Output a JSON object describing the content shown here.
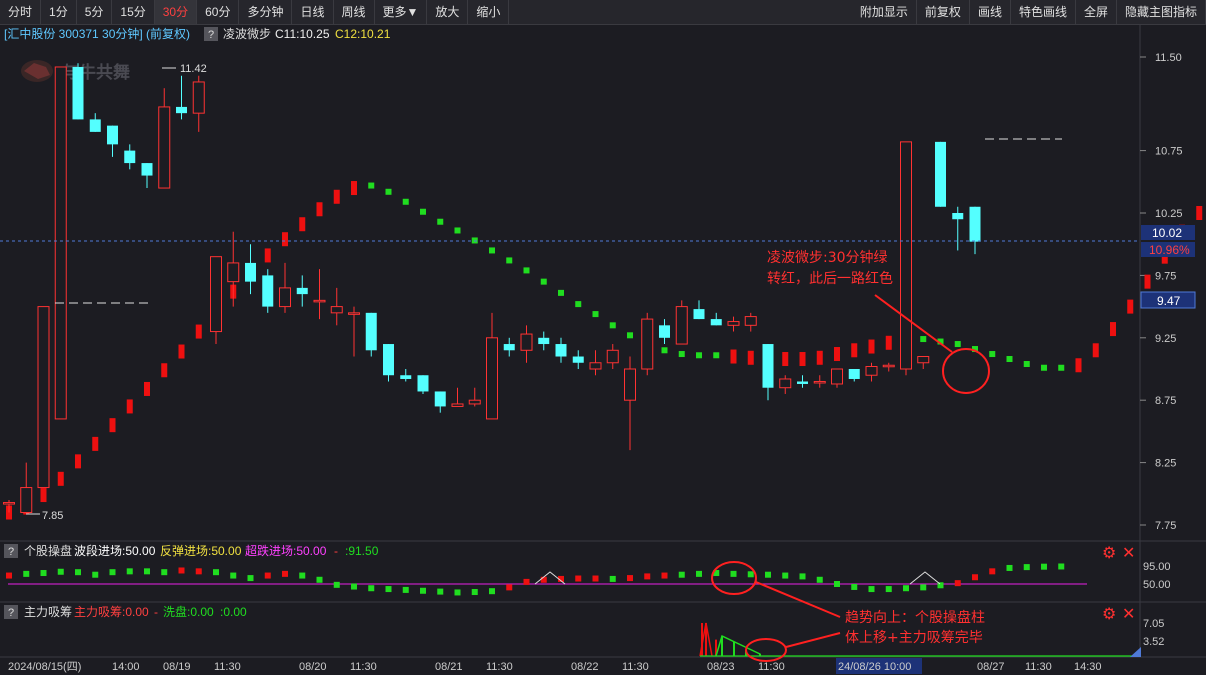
{
  "toolbar": {
    "left": [
      "分时",
      "1分",
      "5分",
      "15分",
      "30分",
      "60分",
      "多分钟",
      "日线",
      "周线",
      "更多▼",
      "放大",
      "缩小"
    ],
    "active": "30分",
    "right": [
      "附加显示",
      "前复权",
      "画线",
      "特色画线",
      "全屏",
      "隐藏主图指标"
    ]
  },
  "main_panel": {
    "stock_label": "[汇中股份 300371 30分钟] (前复权)",
    "help_badge": "?",
    "indicator_name": "凌波微步",
    "c1_text": "C11:10.25",
    "c2_text": "C12:10.21",
    "watermark": "与牛共舞",
    "high_label": "11.42",
    "low_label": "7.85",
    "price_box": "10.02",
    "pct_box": "10.96%",
    "level_box": "9.47",
    "y_ticks": [
      "11.50",
      "10.75",
      "10.25",
      "9.75",
      "9.25",
      "8.75",
      "8.25",
      "7.75"
    ]
  },
  "panel2": {
    "help_badge": "?",
    "name": "个股操盘",
    "s1": "波段进场:50.00",
    "s2": "反弹进场:50.00",
    "s3": "超跌进场:50.00",
    "s4": "-",
    "s5": ":91.50",
    "y_ticks": [
      "95.00",
      "50.00"
    ]
  },
  "panel3": {
    "help_badge": "?",
    "name": "主力吸筹",
    "s1": "主力吸筹:0.00",
    "s2": "-",
    "s3": "洗盘:0.00",
    "s4": ":0.00",
    "y_ticks": [
      "7.05",
      "3.52"
    ]
  },
  "xaxis": {
    "labels": [
      "2024/08/15(四)",
      "14:00",
      "08/19",
      "11:30",
      "08/20",
      "11:30",
      "08/21",
      "11:30",
      "08/22",
      "11:30",
      "08/23",
      "11:30",
      "24/08/26 10:00",
      "08/27",
      "11:30",
      "14:30"
    ],
    "highlight": "24/08/26 10:00"
  },
  "annotations": {
    "a1_line1": "凌波微步:30分钟绿",
    "a1_line2": "转红，此后一路红色",
    "a2_line1": "趋势向上：个股操盘柱",
    "a2_line2": "体上移+主力吸筹完毕"
  },
  "colors": {
    "up": "#ff3232",
    "down": "#54ffff",
    "dot_green": "#20dd20",
    "dot_red": "#ee1010",
    "axis": "#cccccc",
    "grid": "#2e2e36"
  },
  "chart_data": {
    "type": "candlestick",
    "ylim": [
      7.7,
      11.6
    ],
    "candles": [
      {
        "o": 7.92,
        "h": 7.95,
        "l": 7.85,
        "c": 7.93
      },
      {
        "o": 7.85,
        "h": 8.25,
        "l": 7.85,
        "c": 8.05
      },
      {
        "o": 8.05,
        "h": 9.5,
        "l": 8.05,
        "c": 9.5
      },
      {
        "o": 8.6,
        "h": 11.42,
        "l": 8.6,
        "c": 11.42
      },
      {
        "o": 11.42,
        "h": 11.45,
        "l": 11.0,
        "c": 11.0
      },
      {
        "o": 11.0,
        "h": 11.05,
        "l": 10.9,
        "c": 10.9
      },
      {
        "o": 10.95,
        "h": 10.95,
        "l": 10.7,
        "c": 10.8
      },
      {
        "o": 10.75,
        "h": 10.8,
        "l": 10.6,
        "c": 10.65
      },
      {
        "o": 10.65,
        "h": 10.65,
        "l": 10.45,
        "c": 10.55
      },
      {
        "o": 10.45,
        "h": 11.25,
        "l": 10.45,
        "c": 11.1
      },
      {
        "o": 11.1,
        "h": 11.35,
        "l": 11.0,
        "c": 11.05
      },
      {
        "o": 11.05,
        "h": 11.35,
        "l": 10.9,
        "c": 11.3
      },
      {
        "o": 9.3,
        "h": 9.9,
        "l": 9.2,
        "c": 9.9
      },
      {
        "o": 9.7,
        "h": 10.1,
        "l": 9.5,
        "c": 9.85
      },
      {
        "o": 9.85,
        "h": 10.0,
        "l": 9.6,
        "c": 9.7
      },
      {
        "o": 9.75,
        "h": 9.8,
        "l": 9.45,
        "c": 9.5
      },
      {
        "o": 9.5,
        "h": 9.85,
        "l": 9.45,
        "c": 9.65
      },
      {
        "o": 9.65,
        "h": 9.75,
        "l": 9.5,
        "c": 9.6
      },
      {
        "o": 9.55,
        "h": 9.8,
        "l": 9.4,
        "c": 9.55
      },
      {
        "o": 9.45,
        "h": 9.65,
        "l": 9.35,
        "c": 9.5
      },
      {
        "o": 9.45,
        "h": 9.5,
        "l": 9.1,
        "c": 9.45
      },
      {
        "o": 9.45,
        "h": 9.45,
        "l": 9.1,
        "c": 9.15
      },
      {
        "o": 9.2,
        "h": 9.2,
        "l": 8.9,
        "c": 8.95
      },
      {
        "o": 8.95,
        "h": 9.0,
        "l": 8.9,
        "c": 8.92
      },
      {
        "o": 8.95,
        "h": 8.95,
        "l": 8.8,
        "c": 8.82
      },
      {
        "o": 8.82,
        "h": 8.82,
        "l": 8.65,
        "c": 8.7
      },
      {
        "o": 8.7,
        "h": 8.85,
        "l": 8.7,
        "c": 8.72
      },
      {
        "o": 8.72,
        "h": 8.85,
        "l": 8.7,
        "c": 8.75
      },
      {
        "o": 8.6,
        "h": 9.45,
        "l": 8.6,
        "c": 9.25
      },
      {
        "o": 9.2,
        "h": 9.25,
        "l": 9.1,
        "c": 9.15
      },
      {
        "o": 9.15,
        "h": 9.35,
        "l": 9.05,
        "c": 9.28
      },
      {
        "o": 9.25,
        "h": 9.3,
        "l": 9.15,
        "c": 9.2
      },
      {
        "o": 9.2,
        "h": 9.25,
        "l": 9.05,
        "c": 9.1
      },
      {
        "o": 9.1,
        "h": 9.15,
        "l": 9.0,
        "c": 9.05
      },
      {
        "o": 9.0,
        "h": 9.15,
        "l": 8.95,
        "c": 9.05
      },
      {
        "o": 9.05,
        "h": 9.2,
        "l": 9.0,
        "c": 9.15
      },
      {
        "o": 8.75,
        "h": 9.1,
        "l": 8.35,
        "c": 9.0
      },
      {
        "o": 9.0,
        "h": 9.45,
        "l": 8.95,
        "c": 9.4
      },
      {
        "o": 9.35,
        "h": 9.4,
        "l": 9.2,
        "c": 9.25
      },
      {
        "o": 9.2,
        "h": 9.55,
        "l": 9.2,
        "c": 9.5
      },
      {
        "o": 9.48,
        "h": 9.55,
        "l": 9.4,
        "c": 9.4
      },
      {
        "o": 9.4,
        "h": 9.45,
        "l": 9.35,
        "c": 9.35
      },
      {
        "o": 9.35,
        "h": 9.42,
        "l": 9.3,
        "c": 9.38
      },
      {
        "o": 9.35,
        "h": 9.45,
        "l": 9.3,
        "c": 9.42
      },
      {
        "o": 9.2,
        "h": 9.2,
        "l": 8.75,
        "c": 8.85
      },
      {
        "o": 8.85,
        "h": 8.95,
        "l": 8.8,
        "c": 8.92
      },
      {
        "o": 8.9,
        "h": 8.95,
        "l": 8.85,
        "c": 8.88
      },
      {
        "o": 8.9,
        "h": 8.95,
        "l": 8.85,
        "c": 8.9
      },
      {
        "o": 8.88,
        "h": 9.0,
        "l": 8.85,
        "c": 9.0
      },
      {
        "o": 9.0,
        "h": 9.0,
        "l": 8.9,
        "c": 8.92
      },
      {
        "o": 8.95,
        "h": 9.05,
        "l": 8.9,
        "c": 9.02
      },
      {
        "o": 9.02,
        "h": 9.05,
        "l": 8.98,
        "c": 9.03
      },
      {
        "o": 9.0,
        "h": 10.82,
        "l": 8.95,
        "c": 10.82
      },
      {
        "o": 9.05,
        "h": 9.1,
        "l": 9.0,
        "c": 9.1
      },
      {
        "o": 10.82,
        "h": 10.82,
        "l": 10.3,
        "c": 10.3
      },
      {
        "o": 10.25,
        "h": 10.3,
        "l": 9.95,
        "c": 10.2
      },
      {
        "o": 10.3,
        "h": 10.3,
        "l": 9.92,
        "c": 10.02
      }
    ],
    "trail_dots": [
      {
        "v": 7.85,
        "s": "red"
      },
      {
        "v": 7.89,
        "s": "red"
      },
      {
        "v": 7.99,
        "s": "red"
      },
      {
        "v": 8.12,
        "s": "red"
      },
      {
        "v": 8.26,
        "s": "red"
      },
      {
        "v": 8.4,
        "s": "red"
      },
      {
        "v": 8.55,
        "s": "red"
      },
      {
        "v": 8.7,
        "s": "red"
      },
      {
        "v": 8.84,
        "s": "red"
      },
      {
        "v": 8.99,
        "s": "red"
      },
      {
        "v": 9.14,
        "s": "red"
      },
      {
        "v": 9.3,
        "s": "red"
      },
      {
        "v": 9.46,
        "s": "red"
      },
      {
        "v": 9.62,
        "s": "red"
      },
      {
        "v": 9.77,
        "s": "red"
      },
      {
        "v": 9.91,
        "s": "red"
      },
      {
        "v": 10.04,
        "s": "red"
      },
      {
        "v": 10.16,
        "s": "red"
      },
      {
        "v": 10.28,
        "s": "red"
      },
      {
        "v": 10.38,
        "s": "red"
      },
      {
        "v": 10.45,
        "s": "red"
      },
      {
        "v": 10.47,
        "s": "green"
      },
      {
        "v": 10.42,
        "s": "green"
      },
      {
        "v": 10.34,
        "s": "green"
      },
      {
        "v": 10.26,
        "s": "green"
      },
      {
        "v": 10.18,
        "s": "green"
      },
      {
        "v": 10.11,
        "s": "green"
      },
      {
        "v": 10.03,
        "s": "green"
      },
      {
        "v": 9.95,
        "s": "green"
      },
      {
        "v": 9.87,
        "s": "green"
      },
      {
        "v": 9.79,
        "s": "green"
      },
      {
        "v": 9.7,
        "s": "green"
      },
      {
        "v": 9.61,
        "s": "green"
      },
      {
        "v": 9.52,
        "s": "green"
      },
      {
        "v": 9.44,
        "s": "green"
      },
      {
        "v": 9.35,
        "s": "green"
      },
      {
        "v": 9.27,
        "s": "green"
      },
      {
        "v": 9.2,
        "s": "green"
      },
      {
        "v": 9.15,
        "s": "green"
      },
      {
        "v": 9.12,
        "s": "green"
      },
      {
        "v": 9.11,
        "s": "green"
      },
      {
        "v": 9.11,
        "s": "green"
      },
      {
        "v": 9.1,
        "s": "red"
      },
      {
        "v": 9.09,
        "s": "red"
      },
      {
        "v": 9.09,
        "s": "red"
      },
      {
        "v": 9.08,
        "s": "red"
      },
      {
        "v": 9.08,
        "s": "red"
      },
      {
        "v": 9.09,
        "s": "red"
      },
      {
        "v": 9.12,
        "s": "red"
      },
      {
        "v": 9.15,
        "s": "red"
      },
      {
        "v": 9.18,
        "s": "red"
      },
      {
        "v": 9.21,
        "s": "red"
      },
      {
        "v": 9.23,
        "s": "red"
      },
      {
        "v": 9.24,
        "s": "green"
      },
      {
        "v": 9.22,
        "s": "green"
      },
      {
        "v": 9.2,
        "s": "green"
      },
      {
        "v": 9.16,
        "s": "green"
      },
      {
        "v": 9.12,
        "s": "green"
      },
      {
        "v": 9.08,
        "s": "green"
      },
      {
        "v": 9.04,
        "s": "green"
      },
      {
        "v": 9.01,
        "s": "green"
      },
      {
        "v": 9.01,
        "s": "green"
      },
      {
        "v": 9.03,
        "s": "red"
      },
      {
        "v": 9.15,
        "s": "red"
      },
      {
        "v": 9.32,
        "s": "red"
      },
      {
        "v": 9.5,
        "s": "red"
      },
      {
        "v": 9.7,
        "s": "red"
      },
      {
        "v": 9.9,
        "s": "red"
      },
      {
        "v": 10.1,
        "s": "red"
      },
      {
        "v": 10.25,
        "s": "red"
      },
      {
        "v": 10.21,
        "s": "red"
      }
    ],
    "panel2_dots": [
      {
        "v": 70,
        "s": "red"
      },
      {
        "v": 74,
        "s": "green"
      },
      {
        "v": 76,
        "s": "green"
      },
      {
        "v": 79,
        "s": "green"
      },
      {
        "v": 78,
        "s": "green"
      },
      {
        "v": 72,
        "s": "green"
      },
      {
        "v": 78,
        "s": "green"
      },
      {
        "v": 80,
        "s": "green"
      },
      {
        "v": 80,
        "s": "green"
      },
      {
        "v": 78,
        "s": "green"
      },
      {
        "v": 82,
        "s": "red"
      },
      {
        "v": 80,
        "s": "red"
      },
      {
        "v": 78,
        "s": "green"
      },
      {
        "v": 70,
        "s": "green"
      },
      {
        "v": 64,
        "s": "green"
      },
      {
        "v": 70,
        "s": "red"
      },
      {
        "v": 74,
        "s": "red"
      },
      {
        "v": 70,
        "s": "green"
      },
      {
        "v": 60,
        "s": "green"
      },
      {
        "v": 48,
        "s": "green"
      },
      {
        "v": 44,
        "s": "green"
      },
      {
        "v": 40,
        "s": "green"
      },
      {
        "v": 38,
        "s": "green"
      },
      {
        "v": 36,
        "s": "green"
      },
      {
        "v": 34,
        "s": "green"
      },
      {
        "v": 32,
        "s": "green"
      },
      {
        "v": 30,
        "s": "green"
      },
      {
        "v": 31,
        "s": "green"
      },
      {
        "v": 33,
        "s": "green"
      },
      {
        "v": 42,
        "s": "red"
      },
      {
        "v": 55,
        "s": "red"
      },
      {
        "v": 60,
        "s": "red"
      },
      {
        "v": 62,
        "s": "red"
      },
      {
        "v": 63,
        "s": "red"
      },
      {
        "v": 63,
        "s": "red"
      },
      {
        "v": 62,
        "s": "green"
      },
      {
        "v": 64,
        "s": "red"
      },
      {
        "v": 68,
        "s": "red"
      },
      {
        "v": 70,
        "s": "red"
      },
      {
        "v": 72,
        "s": "green"
      },
      {
        "v": 74,
        "s": "green"
      },
      {
        "v": 76,
        "s": "green"
      },
      {
        "v": 74,
        "s": "green"
      },
      {
        "v": 73,
        "s": "green"
      },
      {
        "v": 72,
        "s": "green"
      },
      {
        "v": 70,
        "s": "green"
      },
      {
        "v": 68,
        "s": "green"
      },
      {
        "v": 60,
        "s": "green"
      },
      {
        "v": 50,
        "s": "green"
      },
      {
        "v": 43,
        "s": "green"
      },
      {
        "v": 38,
        "s": "green"
      },
      {
        "v": 38,
        "s": "green"
      },
      {
        "v": 40,
        "s": "green"
      },
      {
        "v": 42,
        "s": "green"
      },
      {
        "v": 47,
        "s": "green"
      },
      {
        "v": 52,
        "s": "red"
      },
      {
        "v": 66,
        "s": "red"
      },
      {
        "v": 80,
        "s": "red"
      },
      {
        "v": 88,
        "s": "green"
      },
      {
        "v": 90,
        "s": "green"
      },
      {
        "v": 91,
        "s": "green"
      },
      {
        "v": 91.5,
        "s": "green"
      }
    ],
    "panel2_triangles": [
      [
        535,
        565
      ],
      [
        910,
        940
      ]
    ],
    "panel3_bars": [
      {
        "x": 702,
        "v": 7.05,
        "c": "red"
      },
      {
        "x": 706,
        "v": 7.05,
        "c": "red"
      },
      {
        "x": 716,
        "v": 3.5,
        "c": "red"
      },
      {
        "x": 722,
        "v": 4.2,
        "c": "green"
      },
      {
        "x": 734,
        "v": 3.0,
        "c": "green"
      },
      {
        "x": 746,
        "v": 1.2,
        "c": "green"
      },
      {
        "x": 760,
        "v": 0.5,
        "c": "green"
      }
    ]
  }
}
